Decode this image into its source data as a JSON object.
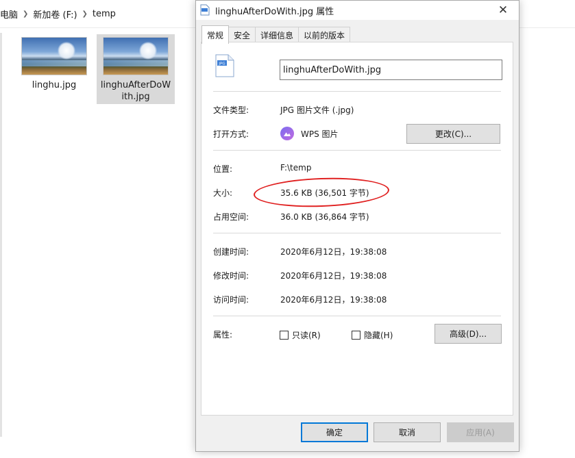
{
  "explorer": {
    "breadcrumb": [
      "电脑",
      "新加卷 (F:)",
      "temp"
    ],
    "files": [
      {
        "name": "linghu.jpg"
      },
      {
        "name": "linghuAfterDoWith.jpg",
        "selected": true
      }
    ]
  },
  "dialog": {
    "title": "linghuAfterDoWith.jpg 属性",
    "tabs": [
      "常规",
      "安全",
      "详细信息",
      "以前的版本"
    ],
    "file_name_value": "linghuAfterDoWith.jpg",
    "file_icon_text": "JPG",
    "labels": {
      "file_type": "文件类型:",
      "opens_with": "打开方式:",
      "location": "位置:",
      "size": "大小:",
      "size_on_disk": "占用空间:",
      "created": "创建时间:",
      "modified": "修改时间:",
      "accessed": "访问时间:",
      "attributes": "属性:"
    },
    "values": {
      "file_type": "JPG 图片文件 (.jpg)",
      "opens_with": "WPS 图片",
      "location": "F:\\temp",
      "size": "35.6 KB (36,501 字节)",
      "size_on_disk": "36.0 KB (36,864 字节)",
      "created": "2020年6月12日，19:38:08",
      "modified": "2020年6月12日，19:38:08",
      "accessed": "2020年6月12日，19:38:08"
    },
    "buttons": {
      "change": "更改(C)...",
      "advanced": "高级(D)...",
      "ok": "确定",
      "cancel": "取消",
      "apply": "应用(A)"
    },
    "checkboxes": {
      "readonly": "只读(R)",
      "hidden": "隐藏(H)"
    },
    "colors": {
      "annotation": "#e02020",
      "accent": "#0078d7"
    }
  }
}
